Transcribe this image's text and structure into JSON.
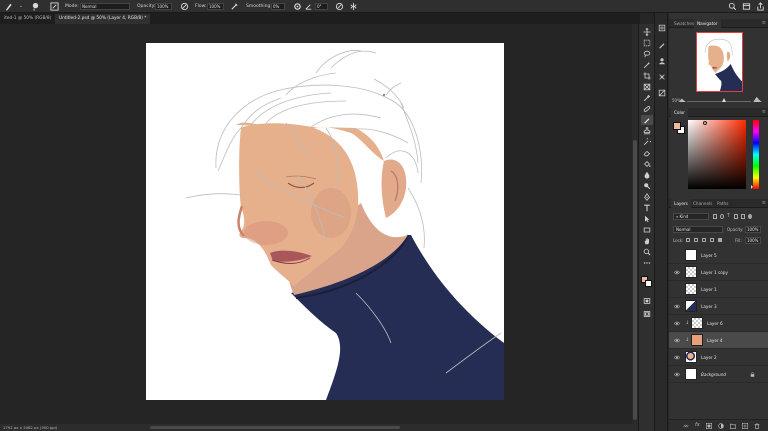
{
  "options_bar": {
    "brush_size": "9",
    "mode_label": "Mode:",
    "mode_value": "Normal",
    "opacity_label": "Opacity:",
    "opacity_value": "100%",
    "flow_label": "Flow:",
    "flow_value": "100%",
    "smoothing_label": "Smoothing:",
    "smoothing_value": "0%",
    "angle_value": "0°"
  },
  "tabs": [
    {
      "label": "ited-1 @ 50% (RGB/8)",
      "active": false
    },
    {
      "label": "Untitled-2.psd @ 50% (Layer 4, RGB/8) *",
      "active": true
    }
  ],
  "status_text": "1792 px x 2082 px (300 ppi)",
  "navigator": {
    "tabs": [
      "Swatches",
      "Navigator"
    ],
    "active_tab": "Navigator",
    "zoom": "50%"
  },
  "color_panel": {
    "tab": "Color",
    "foreground": "#f2b7a0",
    "background": "#ffffff",
    "hue_base": "#ff2a00"
  },
  "layers_panel": {
    "tabs": [
      "Layers",
      "Channels",
      "Paths"
    ],
    "active_tab": "Layers",
    "filter_kind": "Kind",
    "blend_mode": "Normal",
    "opacity_label": "Opacity:",
    "opacity_value": "100%",
    "lock_label": "Lock:",
    "fill_label": "Fill:",
    "fill_value": "100%",
    "layers": [
      {
        "name": "Layer 5",
        "visible": false,
        "thumb": "white",
        "clipped": false,
        "selected": false
      },
      {
        "name": "Layer 1 copy",
        "visible": true,
        "thumb": "checker",
        "clipped": false,
        "selected": false
      },
      {
        "name": "Layer 1",
        "visible": false,
        "thumb": "checker",
        "clipped": false,
        "selected": false
      },
      {
        "name": "Layer 3",
        "visible": true,
        "thumb": "navy",
        "clipped": false,
        "selected": false
      },
      {
        "name": "Layer 6",
        "visible": true,
        "thumb": "checker",
        "clipped": true,
        "selected": false
      },
      {
        "name": "Layer 4",
        "visible": true,
        "thumb": "skin",
        "clipped": true,
        "selected": true
      },
      {
        "name": "Layer 2",
        "visible": true,
        "thumb": "portrait",
        "clipped": false,
        "selected": false
      },
      {
        "name": "Background",
        "visible": true,
        "thumb": "white",
        "clipped": false,
        "selected": false,
        "italic": true,
        "locked": true
      }
    ]
  },
  "colors": {
    "jacket": "#262d54",
    "skin": "#e6b08c",
    "lips": "#a9575a"
  }
}
